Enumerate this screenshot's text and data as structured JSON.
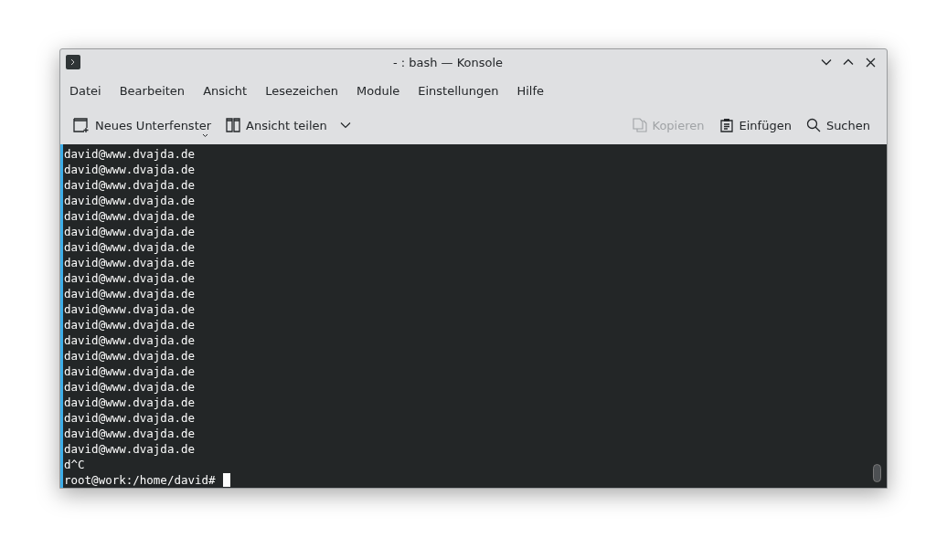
{
  "window": {
    "title": "- : bash — Konsole"
  },
  "menu": [
    "Datei",
    "Bearbeiten",
    "Ansicht",
    "Lesezeichen",
    "Module",
    "Einstellungen",
    "Hilfe"
  ],
  "toolbar_left": [
    {
      "kind": "new-tab",
      "label": "Neues Unterfenster",
      "disabled": false
    },
    {
      "kind": "split",
      "label": "Ansicht teilen",
      "disabled": false
    }
  ],
  "toolbar_right": [
    {
      "kind": "copy",
      "label": "Kopieren",
      "disabled": true
    },
    {
      "kind": "paste",
      "label": "Einfügen",
      "disabled": false
    },
    {
      "kind": "search",
      "label": "Suchen",
      "disabled": false
    }
  ],
  "terminal": {
    "lines": [
      "david@www.dvajda.de",
      "david@www.dvajda.de",
      "david@www.dvajda.de",
      "david@www.dvajda.de",
      "david@www.dvajda.de",
      "david@www.dvajda.de",
      "david@www.dvajda.de",
      "david@www.dvajda.de",
      "david@www.dvajda.de",
      "david@www.dvajda.de",
      "david@www.dvajda.de",
      "david@www.dvajda.de",
      "david@www.dvajda.de",
      "david@www.dvajda.de",
      "david@www.dvajda.de",
      "david@www.dvajda.de",
      "david@www.dvajda.de",
      "david@www.dvajda.de",
      "david@www.dvajda.de",
      "david@www.dvajda.de",
      "d^C"
    ],
    "prompt": "root@work:/home/david#"
  }
}
